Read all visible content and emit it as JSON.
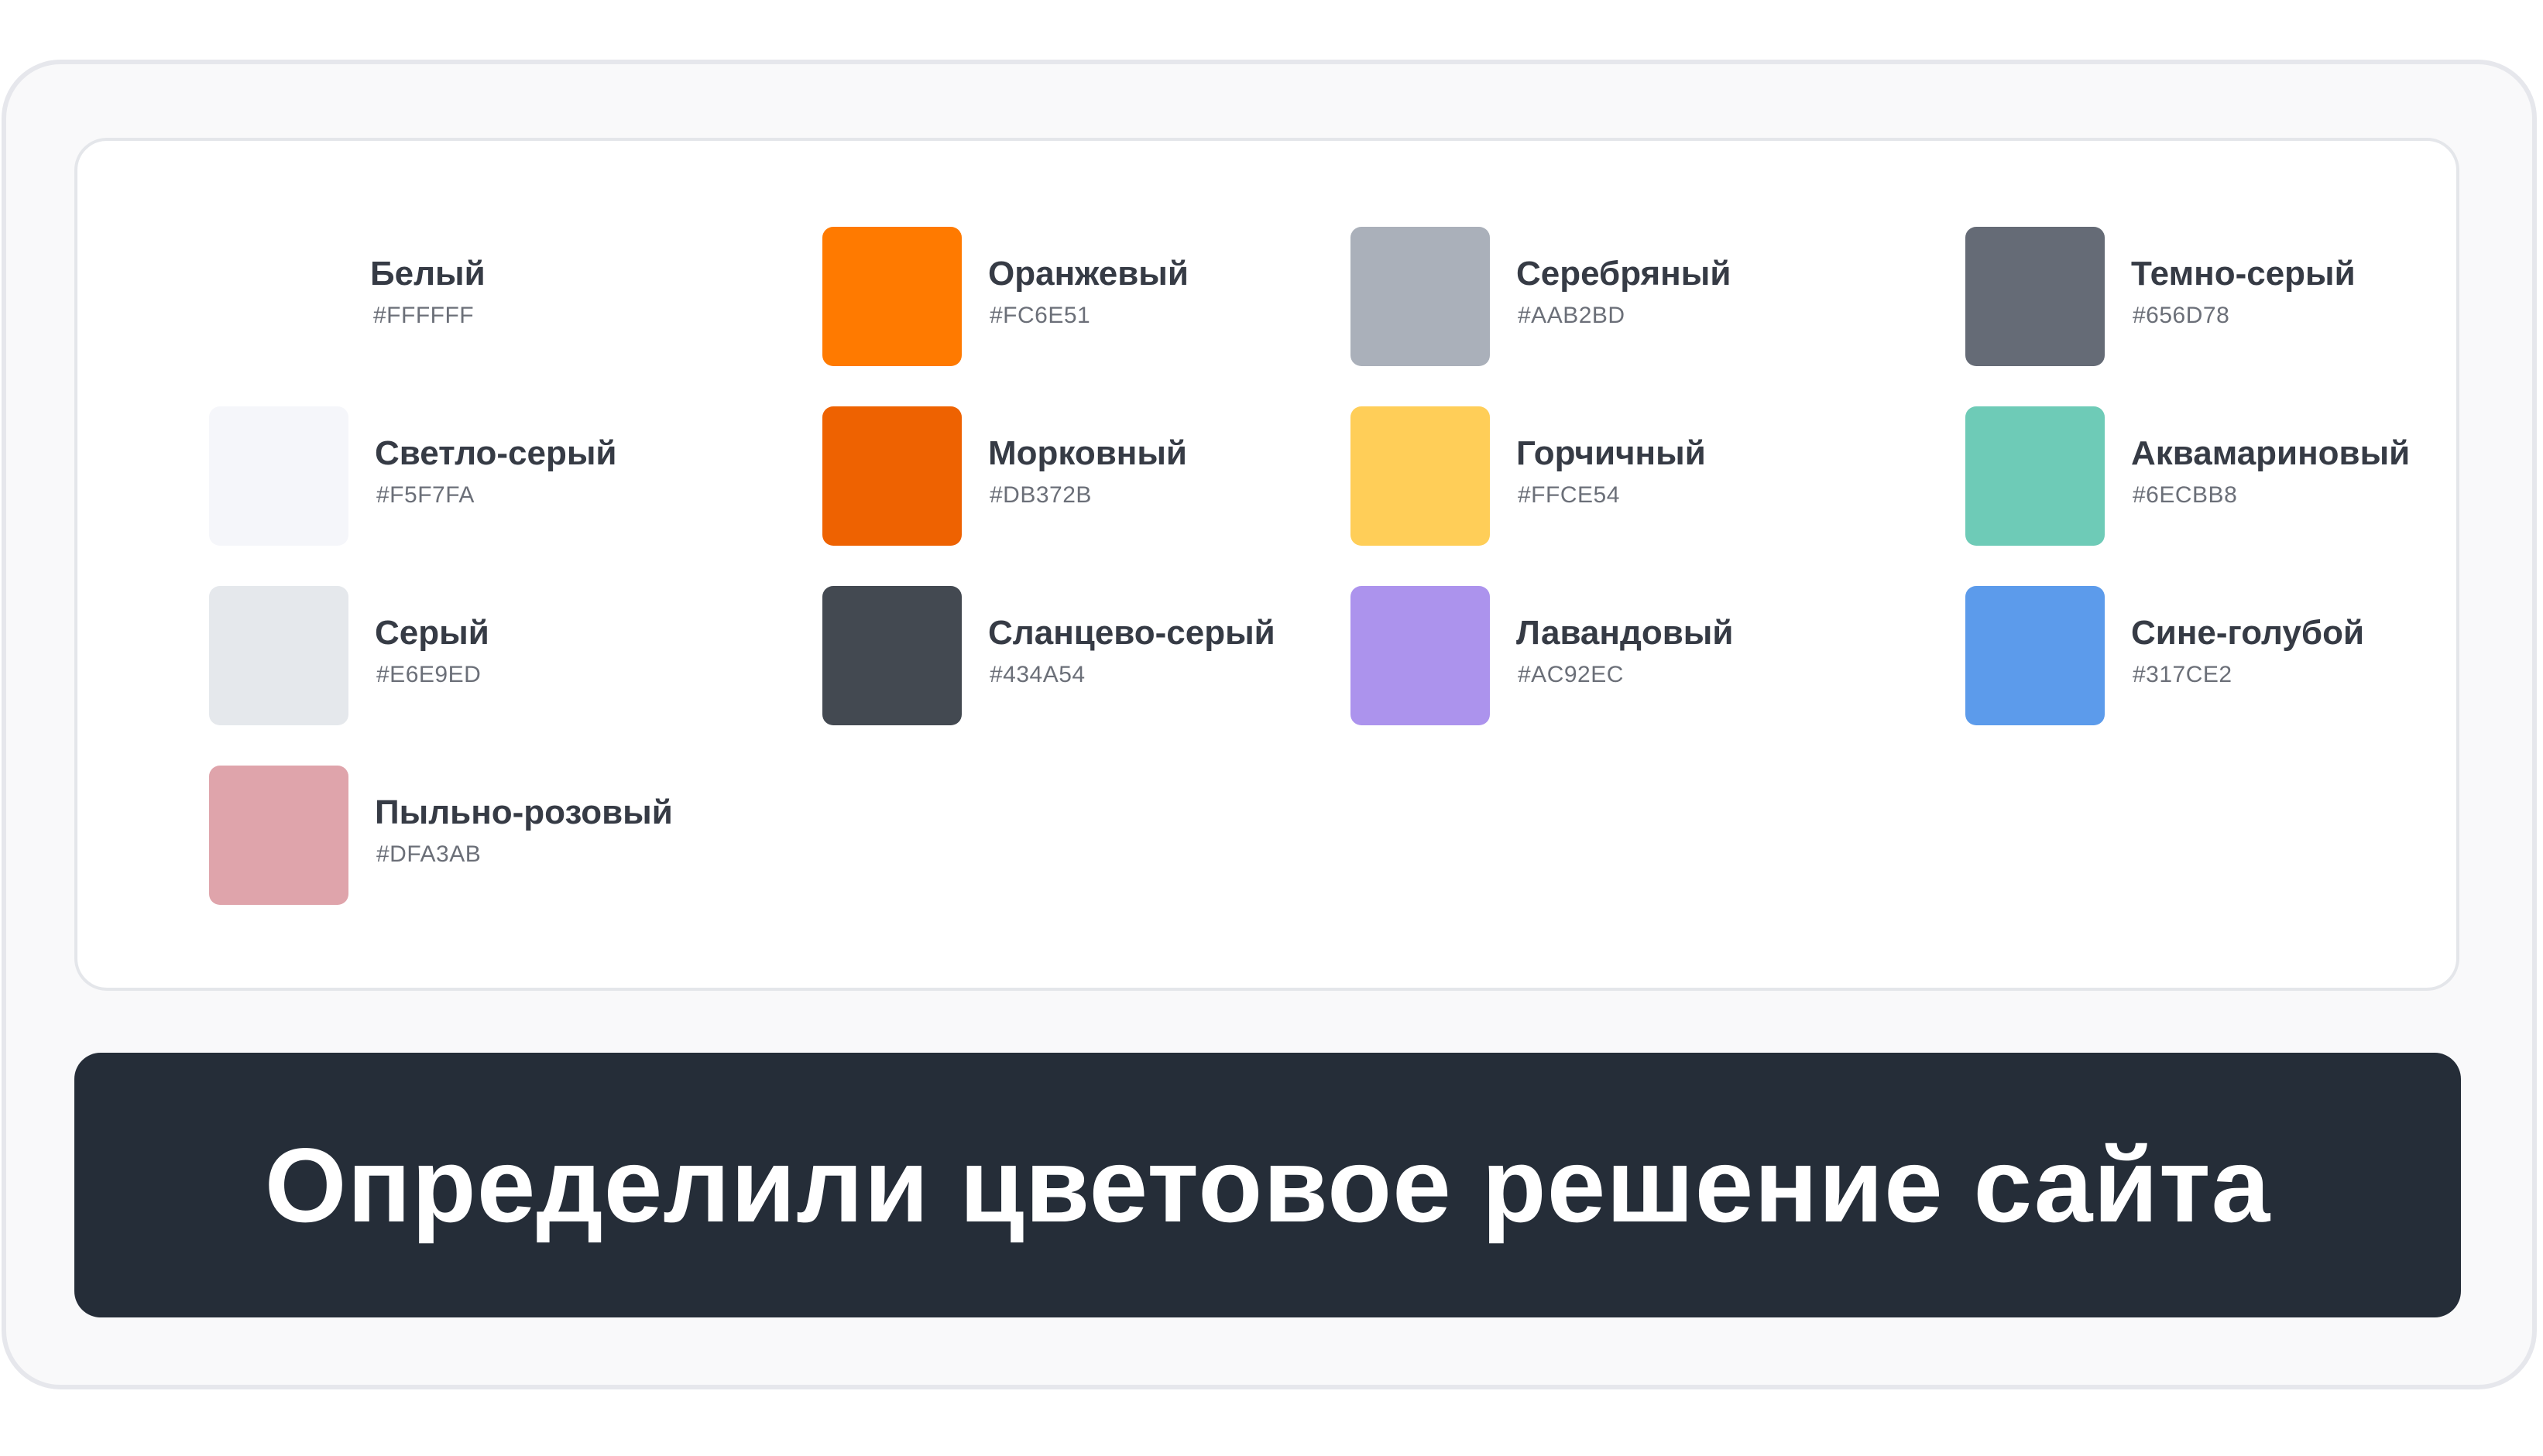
{
  "palette": {
    "colors": [
      {
        "name": "Белый",
        "hex": "#FFFFFF",
        "swatch": "#FFFFFF"
      },
      {
        "name": "Оранжевый",
        "hex": "#FC6E51",
        "swatch": "#FF7A00"
      },
      {
        "name": "Серебряный",
        "hex": "#AAB2BD",
        "swatch": "#AAB0BA"
      },
      {
        "name": "Темно-серый",
        "hex": "#656D78",
        "swatch": "#656B76"
      },
      {
        "name": "Светло-серый",
        "hex": "#F5F7FA",
        "swatch": "#F5F6FA"
      },
      {
        "name": "Морковный",
        "hex": "#DB372B",
        "swatch": "#EE6201"
      },
      {
        "name": "Горчичный",
        "hex": "#FFCE54",
        "swatch": "#FFCE58"
      },
      {
        "name": "Аквамариновый",
        "hex": "#6ECBB8",
        "swatch": "#6ECBB7"
      },
      {
        "name": "Серый",
        "hex": "#E6E9ED",
        "swatch": "#E5E8EC"
      },
      {
        "name": "Сланцево-серый",
        "hex": "#434A54",
        "swatch": "#434951"
      },
      {
        "name": "Лавандовый",
        "hex": "#AC92EC",
        "swatch": "#AC93ED"
      },
      {
        "name": "Сине-голубой",
        "hex": "#317CE2",
        "swatch": "#5C9BEB"
      },
      {
        "name": "Пыльно-розовый",
        "hex": "#DFA3AB",
        "swatch": "#DFA4AB"
      }
    ]
  },
  "banner": {
    "title": "Определили цветовое решение сайта"
  }
}
